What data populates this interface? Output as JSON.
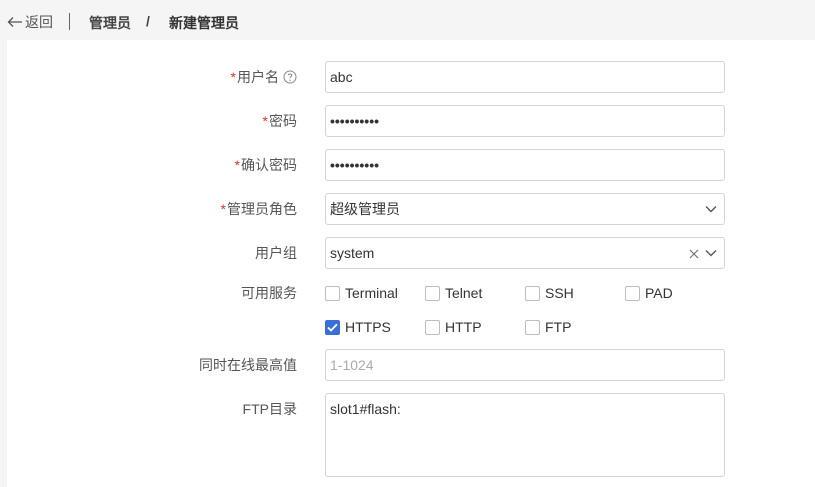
{
  "header": {
    "back_label": "返回",
    "breadcrumb_parent": "管理员",
    "breadcrumb_sep": "/",
    "breadcrumb_current": "新建管理员"
  },
  "form": {
    "required_mark": "*",
    "username": {
      "label": "用户名",
      "value": "abc"
    },
    "password": {
      "label": "密码",
      "value": "••••••••••"
    },
    "confirm_password": {
      "label": "确认密码",
      "value": "••••••••••"
    },
    "role": {
      "label": "管理员角色",
      "value": "超级管理员"
    },
    "user_group": {
      "label": "用户组",
      "value": "system"
    },
    "services": {
      "label": "可用服务",
      "options": [
        {
          "label": "Terminal",
          "checked": false
        },
        {
          "label": "Telnet",
          "checked": false
        },
        {
          "label": "SSH",
          "checked": false
        },
        {
          "label": "PAD",
          "checked": false
        },
        {
          "label": "HTTPS",
          "checked": true
        },
        {
          "label": "HTTP",
          "checked": false
        },
        {
          "label": "FTP",
          "checked": false
        }
      ]
    },
    "max_online": {
      "label": "同时在线最高值",
      "placeholder": "1-1024"
    },
    "ftp_dir": {
      "label": "FTP目录",
      "value": "slot1#flash:"
    }
  },
  "colors": {
    "accent": "#3a6fd8",
    "required": "#e03030",
    "page_bg": "#f5f5f5"
  }
}
